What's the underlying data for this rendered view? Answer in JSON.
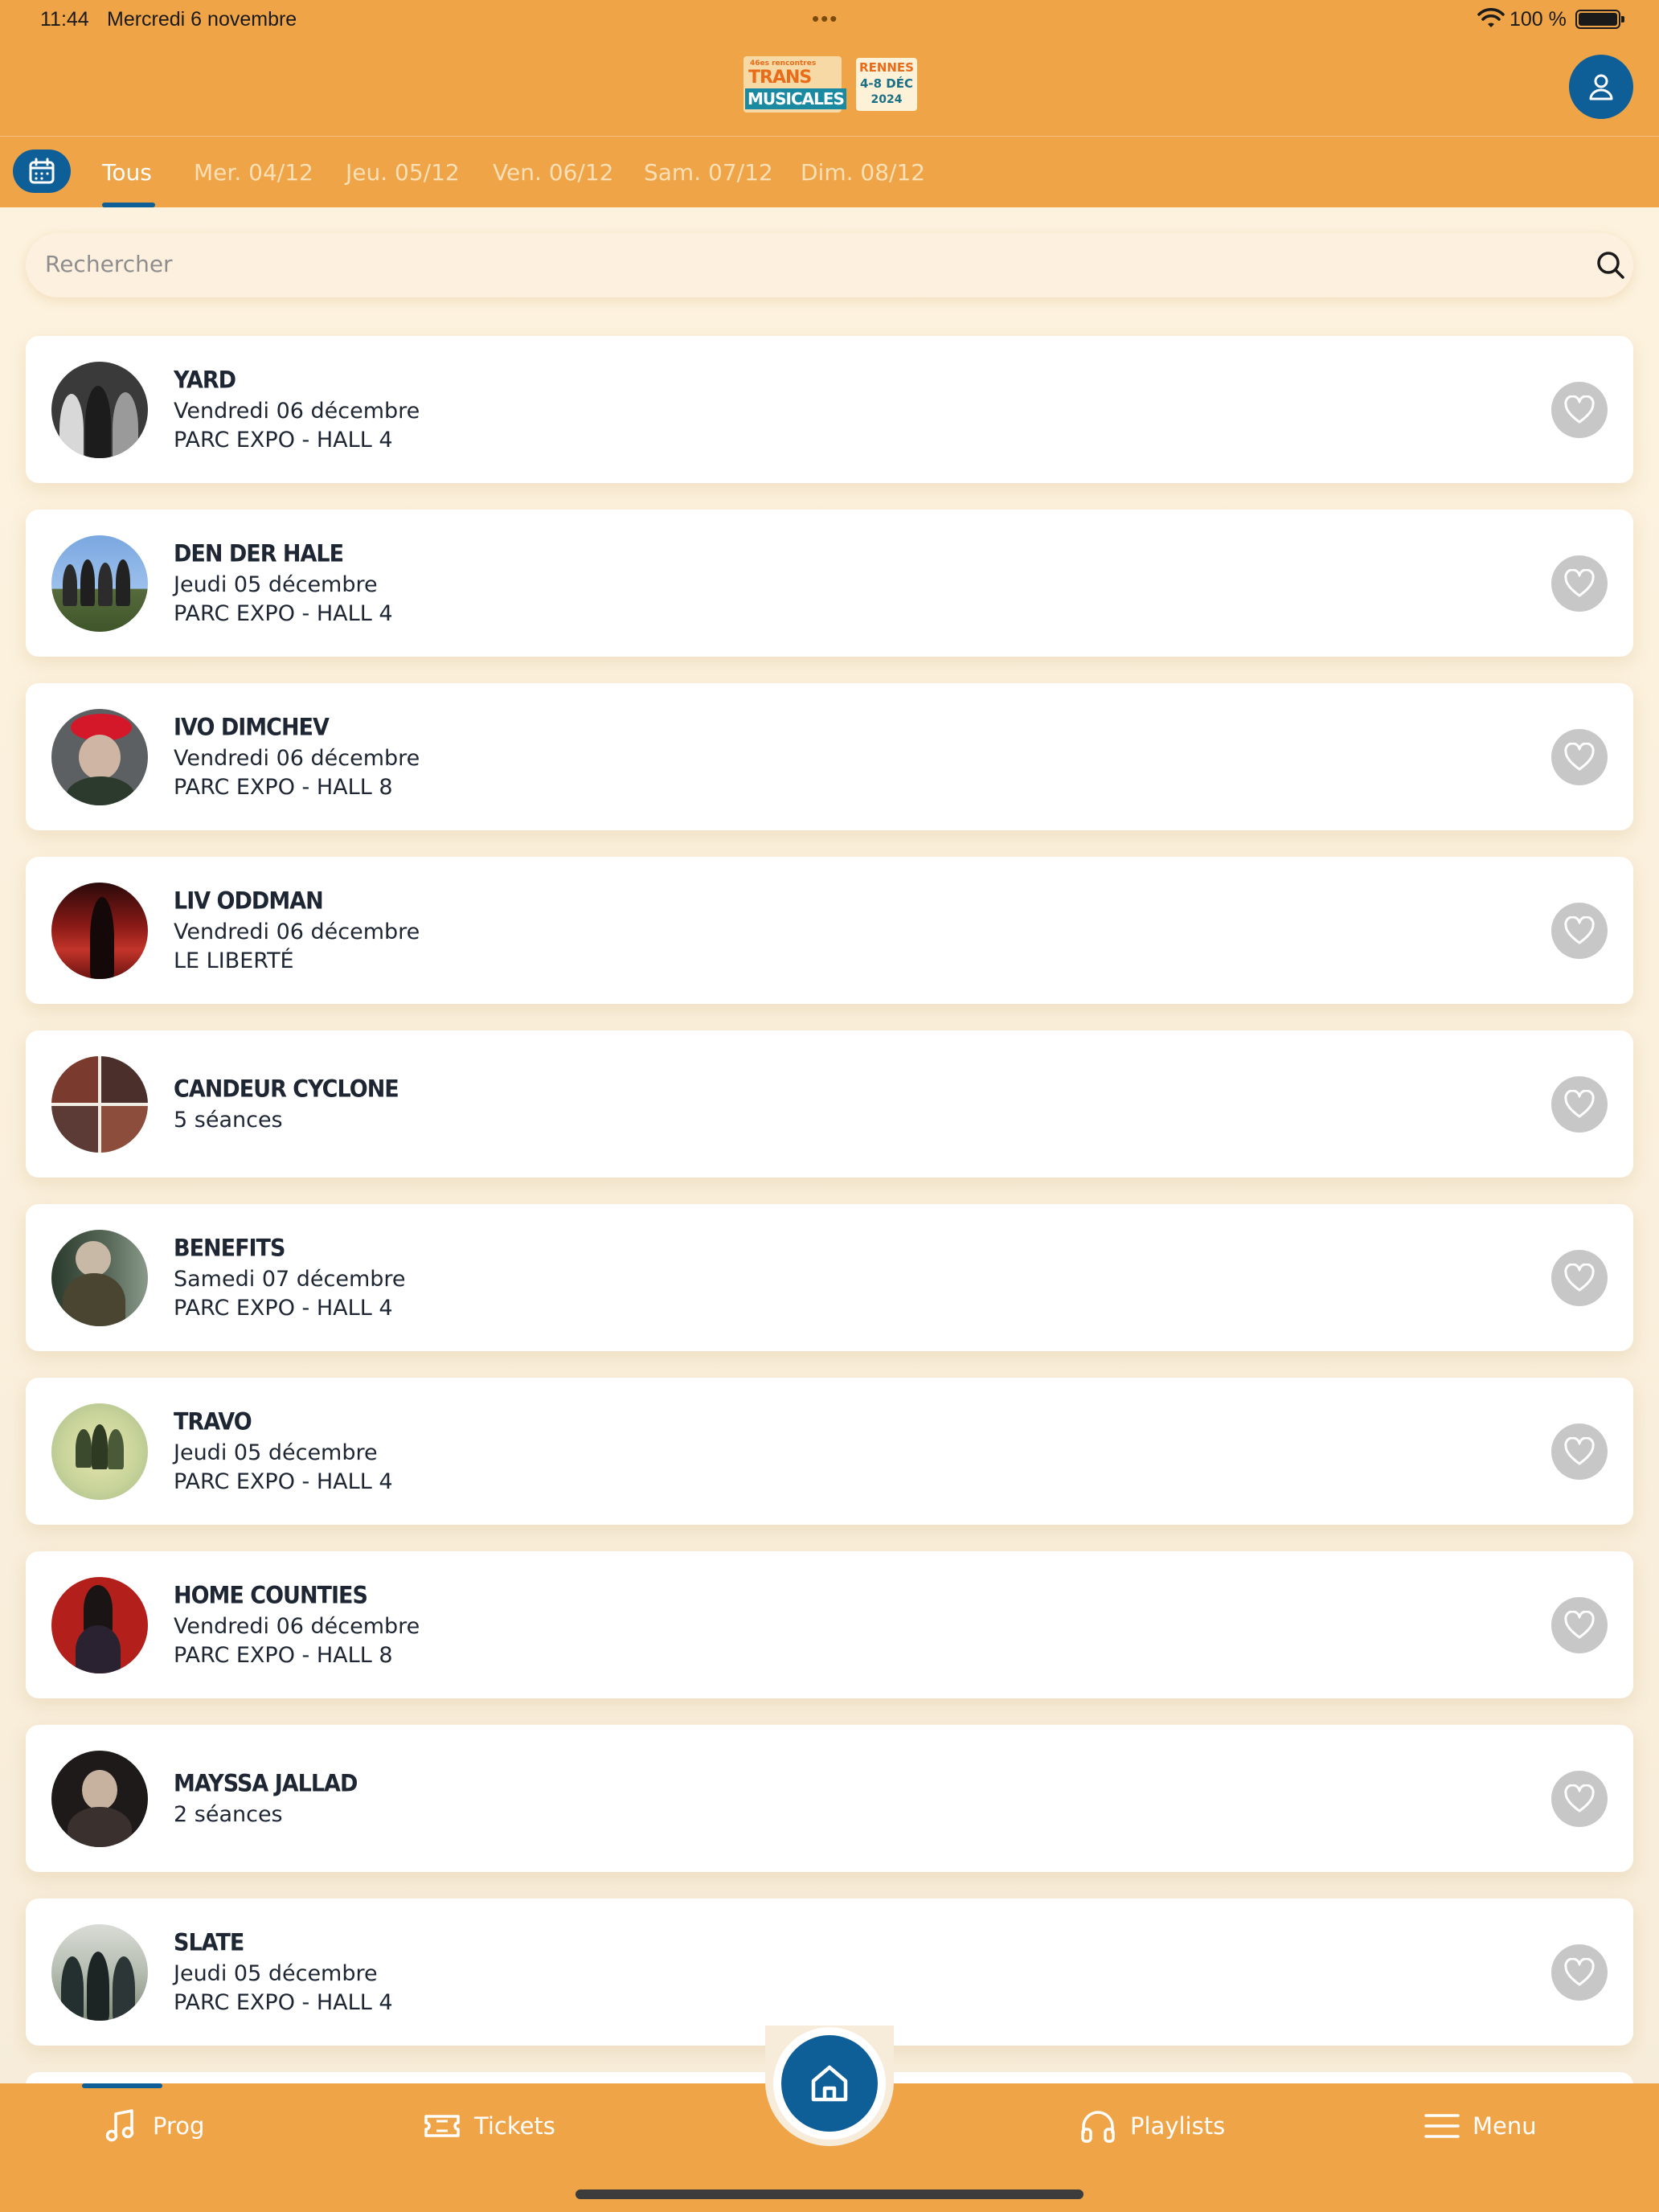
{
  "status_bar": {
    "time": "11:44",
    "date": "Mercredi 6 novembre",
    "dots": "•••",
    "battery_pct": "100 %"
  },
  "header": {
    "logo": {
      "tagline": "46es rencontres",
      "line1": "TRANS",
      "line2": "MUSICALES",
      "city": "RENNES",
      "dates": "4-8 DÉC",
      "year": "2024"
    },
    "profile_icon": "user-icon"
  },
  "tabs": {
    "calendar_icon": "calendar-icon",
    "items": [
      {
        "label": "Tous",
        "active": true
      },
      {
        "label": "Mer. 04/12",
        "active": false
      },
      {
        "label": "Jeu. 05/12",
        "active": false
      },
      {
        "label": "Ven. 06/12",
        "active": false
      },
      {
        "label": "Sam. 07/12",
        "active": false
      },
      {
        "label": "Dim. 08/12",
        "active": false
      }
    ]
  },
  "search": {
    "placeholder": "Rechercher"
  },
  "artists": [
    {
      "name": "YARD",
      "line1": "Vendredi 06 décembre",
      "line2": "PARC EXPO - HALL 4"
    },
    {
      "name": "DEN DER HALE",
      "line1": "Jeudi 05 décembre",
      "line2": "PARC EXPO - HALL 4"
    },
    {
      "name": "IVO DIMCHEV",
      "line1": "Vendredi 06 décembre",
      "line2": "PARC EXPO - HALL 8"
    },
    {
      "name": "LIV ODDMAN",
      "line1": "Vendredi 06 décembre",
      "line2": "LE LIBERTÉ"
    },
    {
      "name": "CANDEUR CYCLONE",
      "line1": "5 séances",
      "line2": ""
    },
    {
      "name": "BENEFITS",
      "line1": "Samedi 07 décembre",
      "line2": "PARC EXPO - HALL 4"
    },
    {
      "name": "TRAVO",
      "line1": "Jeudi 05 décembre",
      "line2": "PARC EXPO - HALL 4"
    },
    {
      "name": "HOME COUNTIES",
      "line1": "Vendredi 06 décembre",
      "line2": "PARC EXPO - HALL 8"
    },
    {
      "name": "MAYSSA JALLAD",
      "line1": "2 séances",
      "line2": ""
    },
    {
      "name": "SLATE",
      "line1": "Jeudi 05 décembre",
      "line2": "PARC EXPO - HALL 4"
    }
  ],
  "bottom_nav": {
    "items": [
      {
        "label": "Prog",
        "icon": "music-note-icon",
        "active": true
      },
      {
        "label": "Tickets",
        "icon": "ticket-icon",
        "active": false
      },
      {
        "label": "Playlists",
        "icon": "headphones-icon",
        "active": false
      },
      {
        "label": "Menu",
        "icon": "hamburger-menu-icon",
        "active": false
      }
    ],
    "home_icon": "home-icon"
  },
  "colors": {
    "brand_orange": "#efa447",
    "brand_blue": "#0e5e97",
    "card_bg": "#ffffff",
    "fav_bg": "#c7c7c7"
  }
}
